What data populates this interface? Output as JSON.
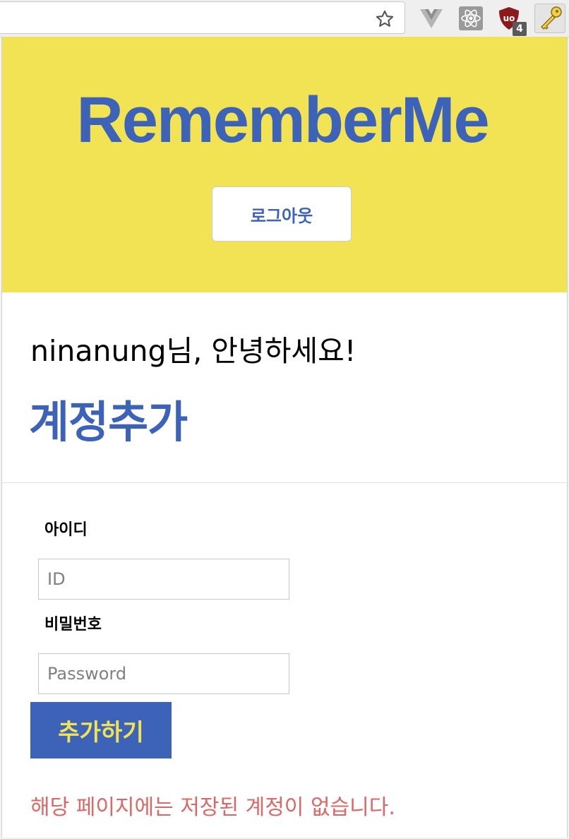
{
  "browser": {
    "extension_badge": "4",
    "icons": [
      "star-icon",
      "vue-devtools-icon",
      "react-devtools-icon",
      "ublock-icon",
      "key-icon"
    ]
  },
  "app": {
    "logo": "RememberMe",
    "logout_label": "로그아웃",
    "greeting": "ninanung님, 안녕하세요!",
    "section_title": "계정추가",
    "form": {
      "id_label": "아이디",
      "id_placeholder": "ID",
      "password_label": "비밀번호",
      "password_placeholder": "Password",
      "submit_label": "추가하기"
    },
    "empty_message": "해당 페이지에는 저장된 계정이 없습니다."
  },
  "colors": {
    "brand_yellow": "#f2e354",
    "brand_blue": "#3d63b8",
    "error_red": "#e06666"
  }
}
